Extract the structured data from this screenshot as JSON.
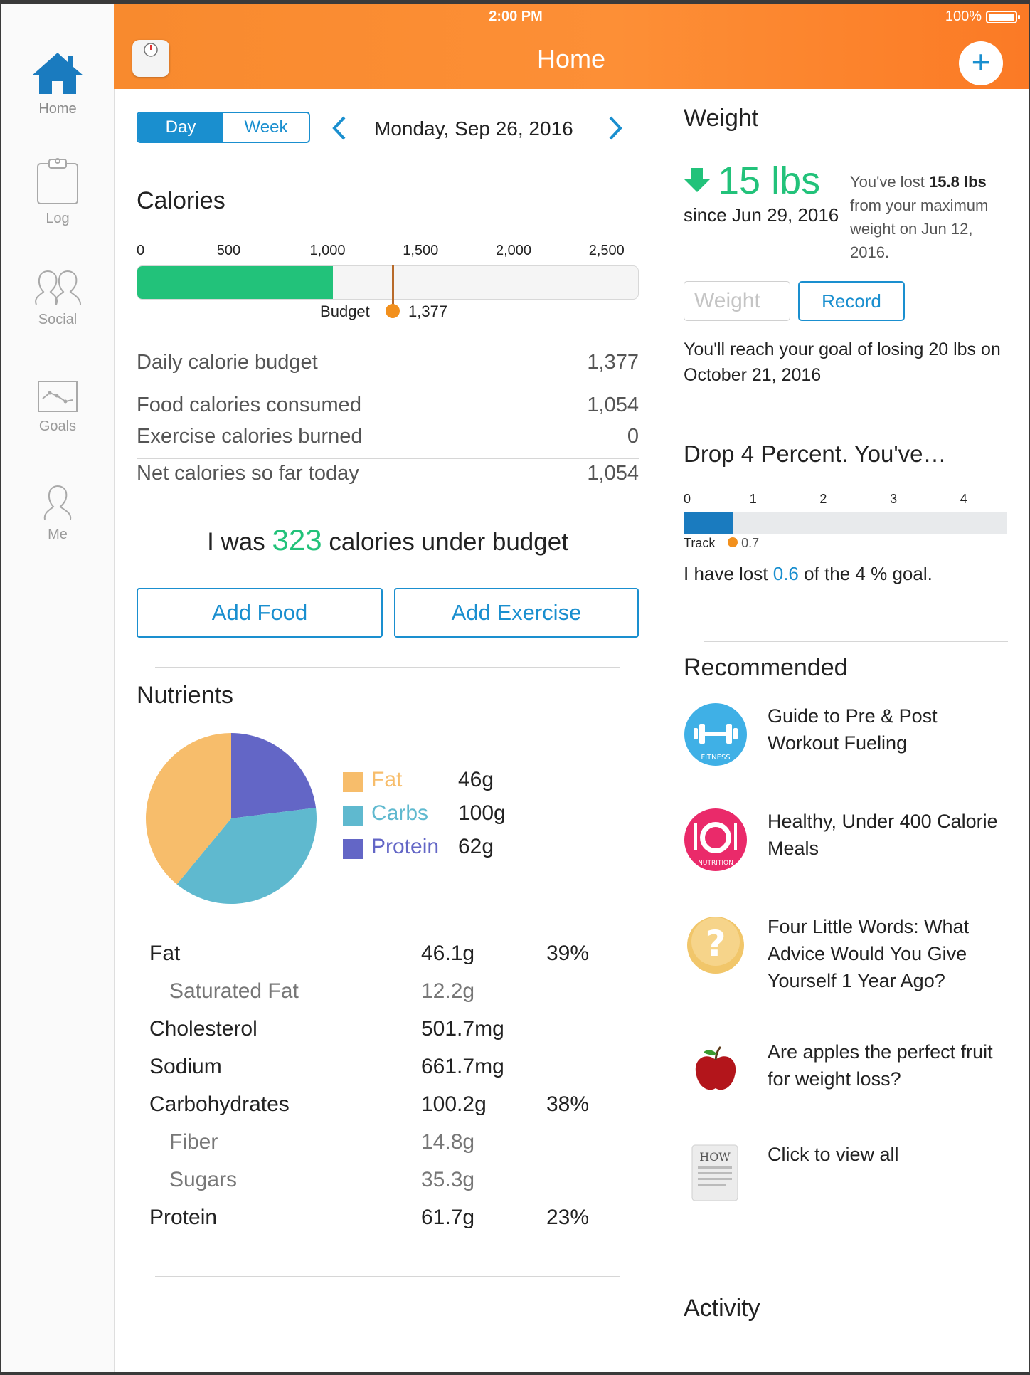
{
  "status_bar": {
    "time": "2:00 PM",
    "battery": "100%"
  },
  "header": {
    "title": "Home"
  },
  "sidebar": {
    "items": [
      {
        "label": "Home",
        "icon": "home-icon",
        "active": true
      },
      {
        "label": "Log",
        "icon": "clipboard-icon"
      },
      {
        "label": "Social",
        "icon": "social-icon"
      },
      {
        "label": "Goals",
        "icon": "goals-chart-icon"
      },
      {
        "label": "Me",
        "icon": "person-icon"
      }
    ]
  },
  "date_nav": {
    "day": "Day",
    "week": "Week",
    "date": "Monday, Sep 26, 2016",
    "selected": "Day"
  },
  "calories": {
    "title": "Calories",
    "scale": [
      "0",
      "500",
      "1,000",
      "1,500",
      "2,000",
      "2,500"
    ],
    "scale_max": 2700,
    "consumed_value": 1054,
    "budget_value": 1377,
    "budget_label": "Budget",
    "budget_display": "1,377",
    "rows": [
      {
        "label": "Daily calorie budget",
        "value": "1,377"
      },
      {
        "label": "Food calories consumed",
        "value": "1,054"
      },
      {
        "label": "Exercise calories burned",
        "value": "0"
      },
      {
        "label": "Net calories so far today",
        "value": "1,054"
      }
    ],
    "under_prefix": "I was",
    "under_number": "323",
    "under_suffix": "calories under budget",
    "add_food": "Add Food",
    "add_exercise": "Add Exercise"
  },
  "nutrients": {
    "title": "Nutrients",
    "legend": [
      {
        "name": "Fat",
        "amount": "46g",
        "color": "#f7bd6b"
      },
      {
        "name": "Carbs",
        "amount": "100g",
        "color": "#5fb9cf"
      },
      {
        "name": "Protein",
        "amount": "62g",
        "color": "#6366c6"
      }
    ],
    "table": [
      {
        "name": "Fat",
        "amount": "46.1g",
        "percent": "39%",
        "sub": false
      },
      {
        "name": "Saturated Fat",
        "amount": "12.2g",
        "percent": "",
        "sub": true
      },
      {
        "name": "Cholesterol",
        "amount": "501.7mg",
        "percent": "",
        "sub": false
      },
      {
        "name": "Sodium",
        "amount": "661.7mg",
        "percent": "",
        "sub": false
      },
      {
        "name": "Carbohydrates",
        "amount": "100.2g",
        "percent": "38%",
        "sub": false
      },
      {
        "name": "Fiber",
        "amount": "14.8g",
        "percent": "",
        "sub": true
      },
      {
        "name": "Sugars",
        "amount": "35.3g",
        "percent": "",
        "sub": true
      },
      {
        "name": "Protein",
        "amount": "61.7g",
        "percent": "23%",
        "sub": false
      }
    ]
  },
  "chart_data": {
    "type": "pie",
    "categories": [
      "Fat",
      "Carbs",
      "Protein"
    ],
    "values": [
      39,
      38,
      23
    ],
    "colors": [
      "#f7bd6b",
      "#5fb9cf",
      "#6366c6"
    ]
  },
  "weight": {
    "title": "Weight",
    "lost": "15 lbs",
    "since": "since Jun 29, 2016",
    "note_prefix": "You've lost",
    "note_bold": "15.8 lbs",
    "note_suffix": "from your maximum weight on Jun 12, 2016.",
    "input_placeholder": "Weight",
    "record": "Record",
    "goal": "You'll reach your goal of losing 20 lbs on October 21, 2016"
  },
  "percent_goal": {
    "title": "Drop 4 Percent. You've…",
    "scale": [
      "0",
      "1",
      "2",
      "3",
      "4"
    ],
    "scale_max": 4.6,
    "track_label": "Track",
    "track_value": 0.7,
    "track_display": "0.7",
    "lost_prefix": "I have lost",
    "lost_value": "0.6",
    "lost_suffix": "of the 4 % goal."
  },
  "recommended": {
    "title": "Recommended",
    "items": [
      {
        "text": "Guide to Pre & Post Workout Fueling",
        "icon": "fitness-icon",
        "badge": "FITNESS"
      },
      {
        "text": "Healthy, Under 400 Calorie Meals",
        "icon": "nutrition-icon",
        "badge": "NUTRITION"
      },
      {
        "text": "Four Little Words: What Advice Would You Give Yourself 1 Year Ago?",
        "icon": "question-icon"
      },
      {
        "text": "Are apples the perfect fruit for weight loss?",
        "icon": "apple-icon"
      },
      {
        "text": "Click to view all",
        "icon": "book-icon",
        "badge": "HOW"
      }
    ]
  },
  "activity": {
    "title": "Activity"
  }
}
